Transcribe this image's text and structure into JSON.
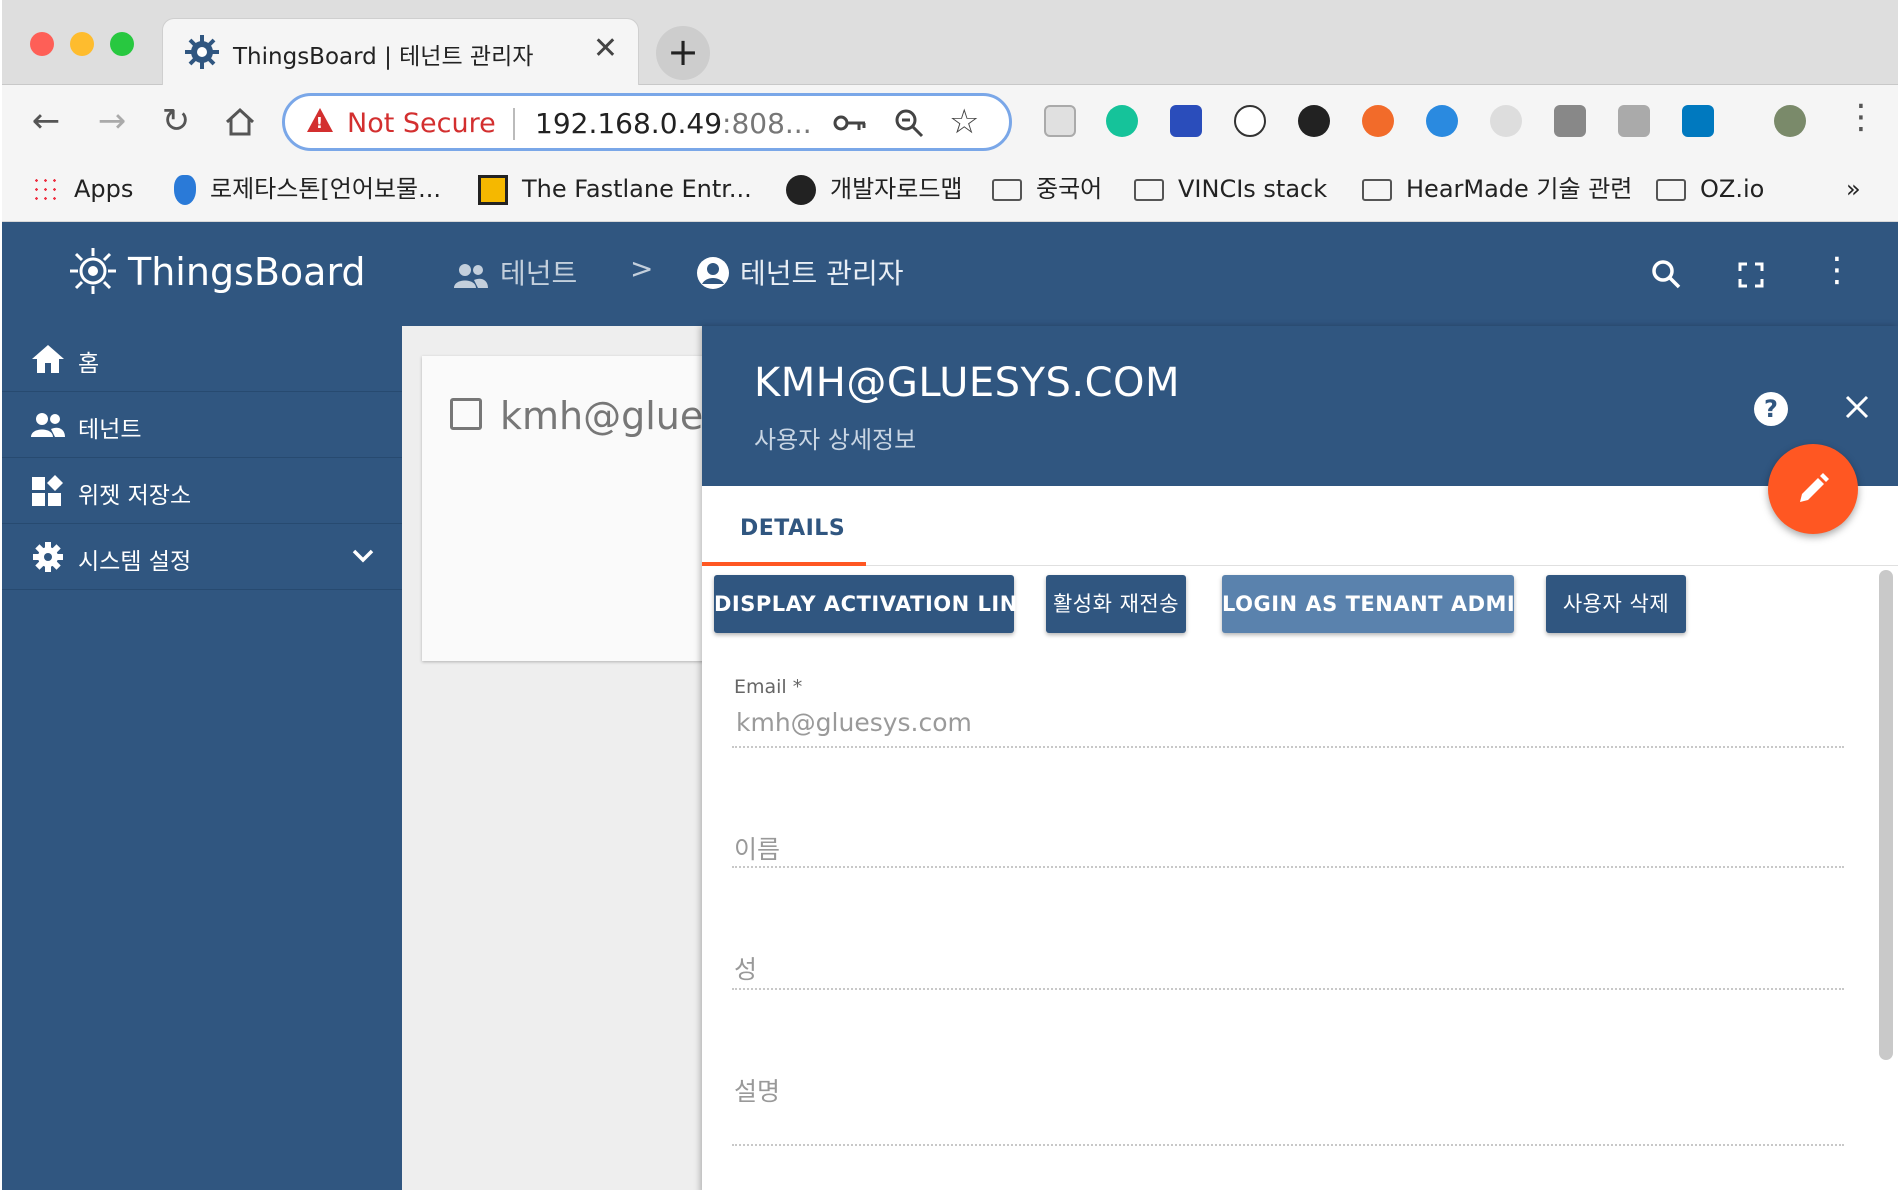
{
  "browser": {
    "tab_title": "ThingsBoard | 테넌트 관리자",
    "tab_close": "✕",
    "new_tab": "+",
    "security_text": "Not Secure",
    "url_main": "192.168.0.49",
    "url_rest": ":808...",
    "bookmarks": [
      {
        "label": "Apps"
      },
      {
        "label": "로제타스톤[언어보물..."
      },
      {
        "label": "The Fastlane Entr..."
      },
      {
        "label": "개발자로드맵"
      },
      {
        "label": "중국어"
      },
      {
        "label": "VINCIs stack"
      },
      {
        "label": "HearMade 기술 관련"
      },
      {
        "label": "OZ.io"
      }
    ],
    "bookmarks_more": "»"
  },
  "app": {
    "name": "ThingsBoard",
    "breadcrumb": [
      {
        "label": "테넌트"
      },
      {
        "label": "테넌트 관리자"
      }
    ],
    "breadcrumb_sep": ">"
  },
  "sidebar": {
    "items": [
      {
        "label": "홈",
        "icon": "home-icon"
      },
      {
        "label": "테넌트",
        "icon": "people-icon"
      },
      {
        "label": "위젯 저장소",
        "icon": "widgets-icon"
      },
      {
        "label": "시스템 설정",
        "icon": "gear-icon"
      }
    ]
  },
  "list": {
    "card_text": "kmh@glues"
  },
  "detail": {
    "title": "KMH@GLUESYS.COM",
    "subtitle": "사용자 상세정보",
    "tab": "DETAILS",
    "buttons": {
      "activation": "DISPLAY ACTIVATION LINK",
      "resend": "활성화 재전송",
      "login": "LOGIN AS TENANT ADMIN",
      "delete": "사용자 삭제"
    },
    "fields": {
      "email_label": "Email *",
      "email_value": "kmh@gluesys.com",
      "first_name": "이름",
      "last_name": "성",
      "description": "설명"
    }
  },
  "colors": {
    "primary": "#305680",
    "accent": "#ff5722",
    "warning": "#d32f2f"
  }
}
